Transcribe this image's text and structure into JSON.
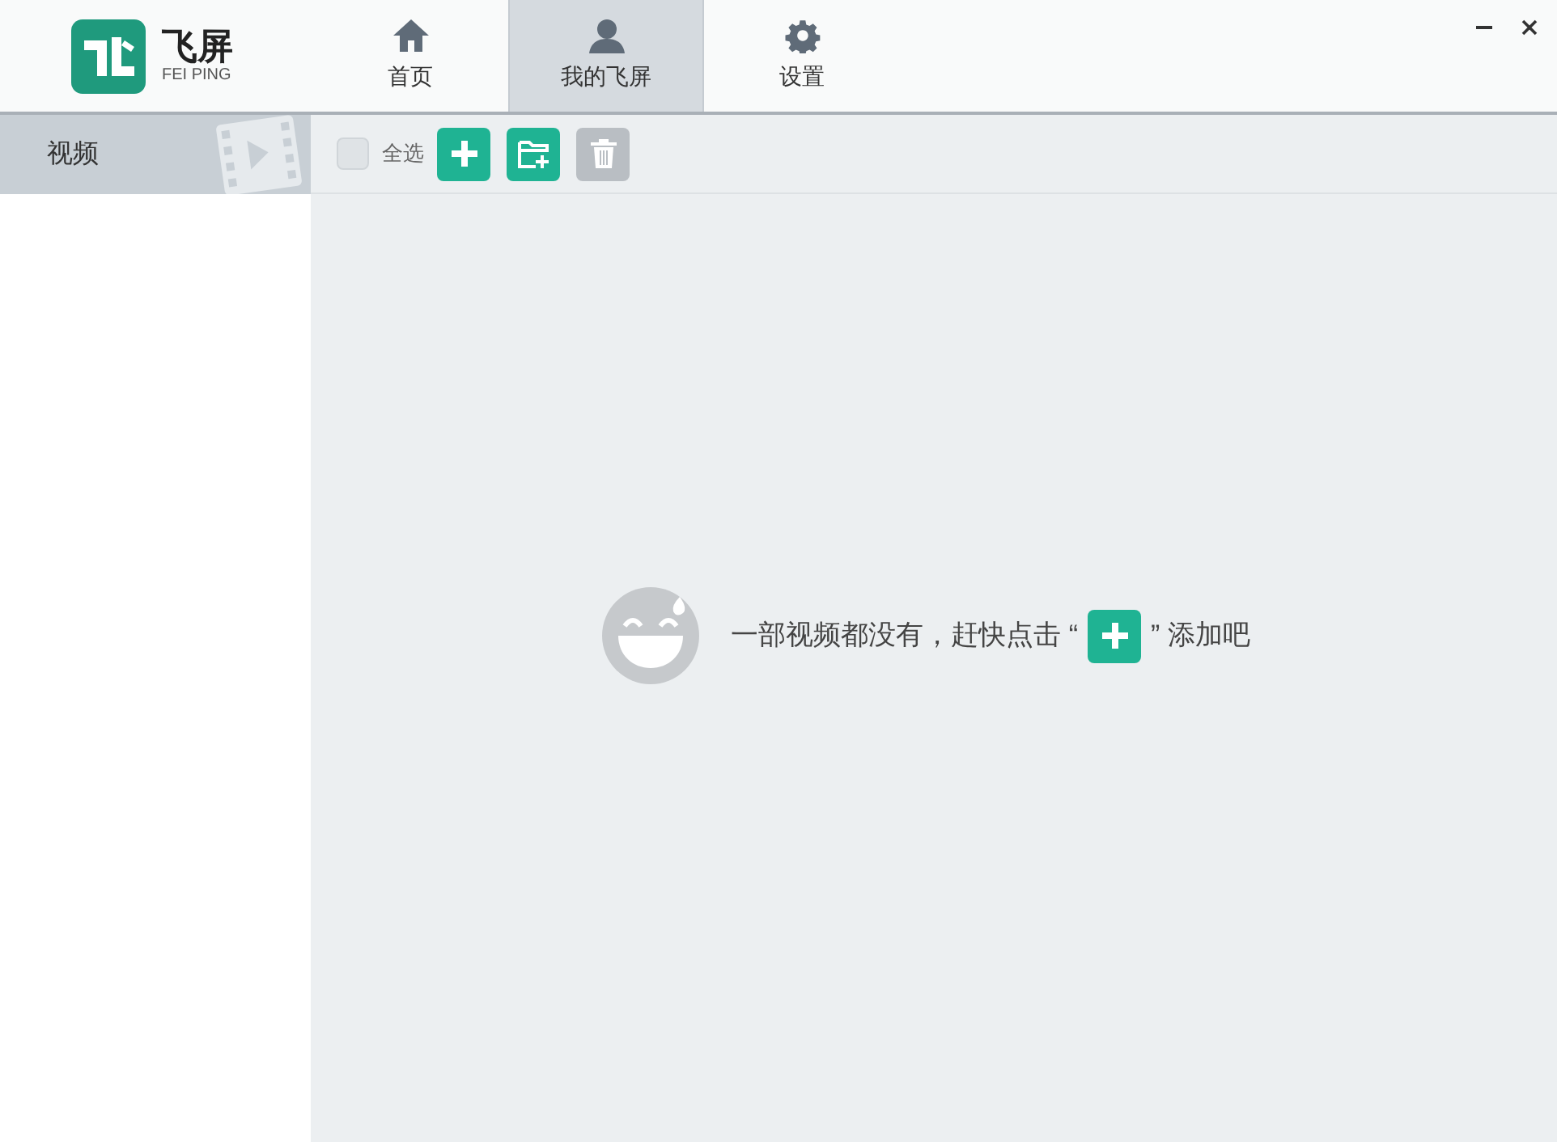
{
  "app": {
    "name": "飞屏",
    "subtitle": "FEI PING"
  },
  "tabs": [
    {
      "label": "首页",
      "kind": "home",
      "selected": false
    },
    {
      "label": "我的飞屏",
      "kind": "user",
      "selected": true
    },
    {
      "label": "设置",
      "kind": "gear",
      "selected": false
    }
  ],
  "sidebar": {
    "items": [
      {
        "label": "视频",
        "selected": true
      }
    ]
  },
  "toolbar": {
    "select_all": {
      "label": "全选",
      "checked": false
    },
    "buttons": [
      {
        "kind": "add",
        "disabled": false
      },
      {
        "kind": "add-folder",
        "disabled": false
      },
      {
        "kind": "delete",
        "disabled": true
      }
    ]
  },
  "empty_state": {
    "text_before": "一部视频都没有，赶快点击 “",
    "text_after": "” 添加吧"
  }
}
